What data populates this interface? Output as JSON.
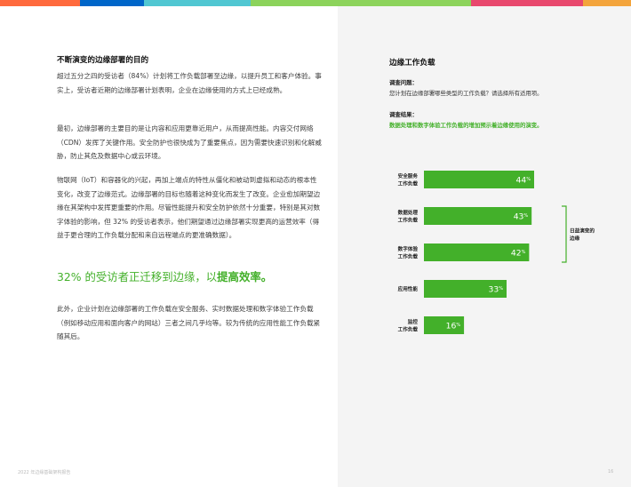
{
  "colors": {
    "accent_green": "#43b02a",
    "bar_green": "#43b02a",
    "top_bar": [
      "#ff6a3d",
      "#0066c9",
      "#51c7d2",
      "#8cd35b",
      "#8cd35b",
      "#e8486d",
      "#f3a43c"
    ]
  },
  "left": {
    "title": "不断演变的边缘部署的目的",
    "para1": "超过五分之四的受访者（84%）计划将工作负载部署至边缘，以提升员工和客户体验。事实上，受访者近期的边缘部署计划表明，企业在边缘使用的方式上已经成熟。",
    "para2": "最初，边缘部署的主要目的是让内容和应用更靠近用户，从而提高性能。内容交付网络（CDN）发挥了关键作用。安全防护也很快成为了重要焦点，因为需要快速识别和化解威胁，防止其危及数据中心或云环境。",
    "para3": "物联网（IoT）和容器化的兴起，再加上端点的特性从僵化和被动到虚拟和动态的根本性变化，改变了边缘范式。边缘部署的目标也随着这种变化而发生了改变。企业愈加期望边缘在其架构中发挥更重要的作用。尽管性能提升和安全防护依然十分重要，特别是其对数字体验的影响，但 32% 的受访者表示，他们期望通过边缘部署实现更高的运营效率（得益于更合理的工作负载分配和来自远程端点的更准确数据）。",
    "highlight_prefix": "32% 的受访者正迁移到边缘，以",
    "highlight_bold": "提高效率。",
    "para4": "此外，企业计划在边缘部署的工作负载在安全服务、实时数据处理和数字体验工作负载（例如移动应用和面向客户的网站）三者之间几乎均等。较为传统的应用性能工作负载紧随其后。"
  },
  "right": {
    "title": "边缘工作负载",
    "question_label": "调查问题：",
    "question_text": "您计划在边缘部署哪些类型的工作负载？请选择所有适用项。",
    "result_label": "调查结果：",
    "result_text": "数据处理和数字体验工作负载的增加预示着边缘使用的演变。"
  },
  "chart_data": {
    "type": "bar",
    "orientation": "horizontal",
    "categories": [
      [
        "安全服务",
        "工作负载"
      ],
      [
        "数据处理",
        "工作负载"
      ],
      [
        "数字体验",
        "工作负载"
      ],
      [
        "应用性能"
      ],
      [
        "监控",
        "工作负载"
      ]
    ],
    "values": [
      44,
      43,
      42,
      33,
      16
    ],
    "value_suffix": "%",
    "xlim": [
      0,
      50
    ],
    "annotation": {
      "text": [
        "日益演变的",
        "边缘"
      ],
      "spans": [
        1,
        2
      ]
    }
  },
  "footer": {
    "left_text": "2022 年边缘基础架构报告",
    "page_number": "16"
  }
}
